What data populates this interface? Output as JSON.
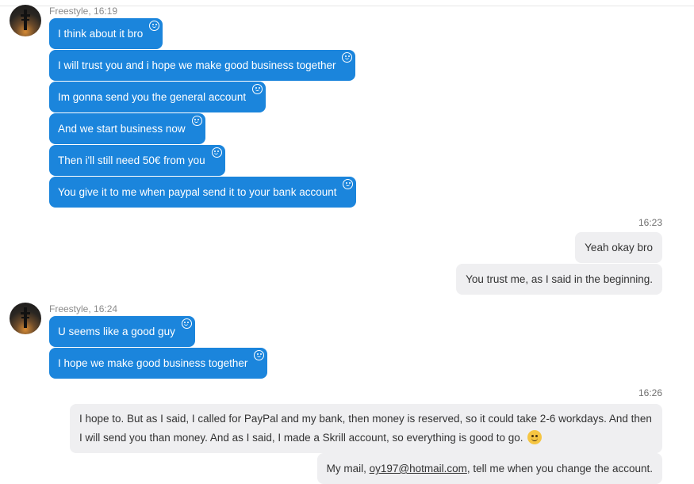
{
  "groups": [
    {
      "sender": "Freestyle, 16:19",
      "messages": [
        "I think about it bro",
        "I will trust you and i hope we make good business together",
        "Im gonna send you the general account",
        "And we start business now",
        "Then i'll still need 50€ from you",
        "You give it to me when paypal send it to your bank account"
      ]
    },
    {
      "time": "16:23",
      "messages": [
        "Yeah okay bro",
        "You trust me, as I said in the beginning."
      ]
    },
    {
      "sender": "Freestyle, 16:24",
      "messages": [
        "U seems like a good guy",
        "I hope we make good business together"
      ]
    },
    {
      "time": "16:26",
      "messages": [
        "I hope to. But as I said, I called for PayPal and my bank, then money is reserved, so it could take 2-6 workdays. And then I will send you than money. And as I said, I made a Skrill account, so everything is good to go.",
        {
          "prefix": "My mail, ",
          "email": "oy197@hotmail.com",
          "suffix": ", tell me when you change the account."
        }
      ]
    }
  ],
  "colors": {
    "incoming_bubble": "#1b85dc",
    "outgoing_bubble": "#efeff1"
  },
  "icons": {
    "reaction": "smiley-outline-icon",
    "avatar": "contact-avatar",
    "inline_emoji": "smirk-emoji-icon"
  }
}
